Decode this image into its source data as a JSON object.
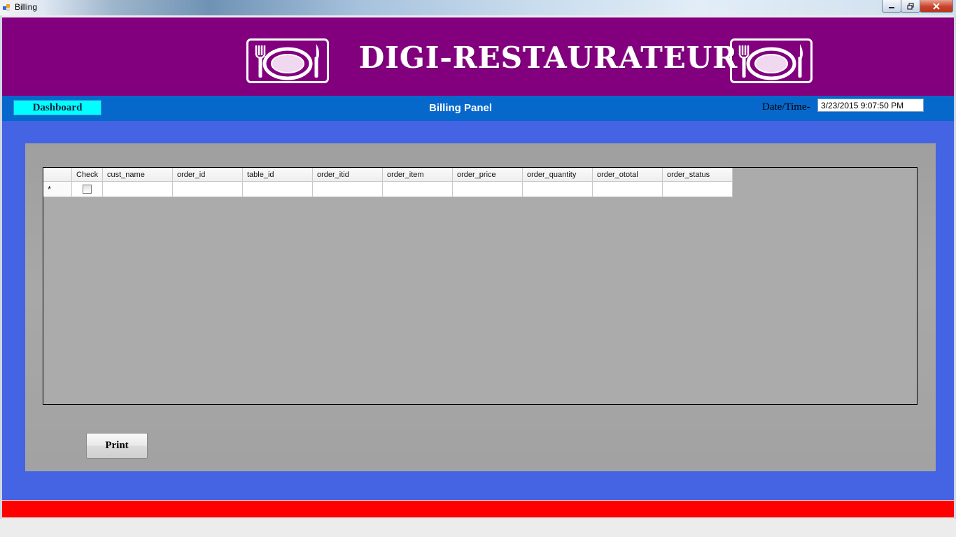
{
  "window": {
    "title": "Billing",
    "minimize_icon": "minimize-icon",
    "maximize_icon": "maximize-icon",
    "close_icon": "close-icon"
  },
  "header": {
    "app_title": "DIGI-RESTAURATEUR",
    "logo_icon": "plate-cutlery-icon"
  },
  "nav": {
    "dashboard_label": "Dashboard",
    "panel_title": "Billing Panel",
    "datetime_label": "Date/Time-",
    "datetime_value": "3/23/2015 9:07:50 PM"
  },
  "grid": {
    "columns": [
      "Check",
      "cust_name",
      "order_id",
      "table_id",
      "order_itid",
      "order_item",
      "order_price",
      "order_quantity",
      "order_ototal",
      "order_status"
    ],
    "new_row_marker": "*"
  },
  "actions": {
    "print_label": "Print"
  },
  "colors": {
    "header_bg": "#82007e",
    "nav_bg": "#0768cc",
    "main_bg": "#4464e4",
    "footer_bg": "#ff0000",
    "dashboard_btn_bg": "#00ffff"
  }
}
